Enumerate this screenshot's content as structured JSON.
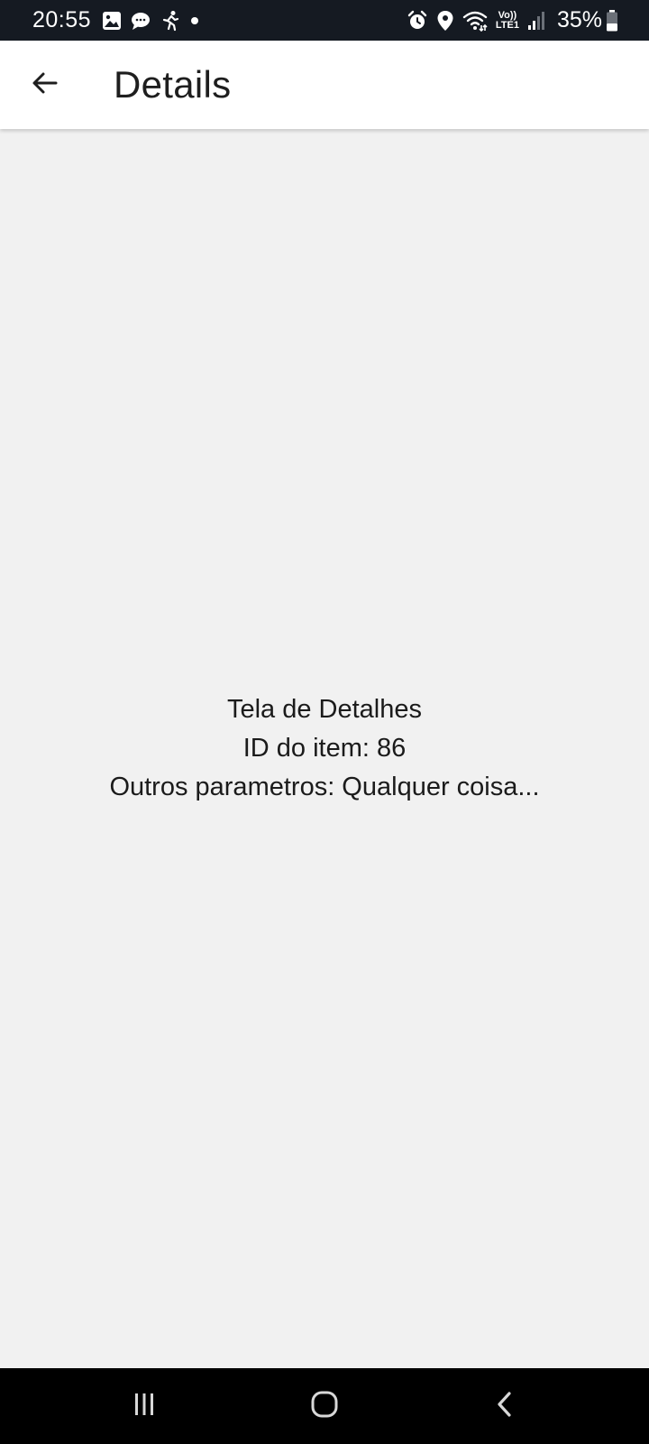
{
  "status_bar": {
    "time": "20:55",
    "battery_percent": "35%",
    "network_label_top": "Vo))",
    "network_label_bottom": "LTE1",
    "left_icons": [
      "gallery-icon",
      "chat-bubble-icon",
      "running-person-icon",
      "notification-dot-icon"
    ],
    "right_icons": [
      "alarm-icon",
      "location-pin-icon",
      "wifi-icon",
      "volte-lte-icon",
      "signal-icon",
      "battery-icon"
    ]
  },
  "app_bar": {
    "back_icon": "arrow-back-icon",
    "title": "Details"
  },
  "content": {
    "lines": [
      "Tela de Detalhes",
      "ID do item: 86",
      "Outros parametros: Qualquer coisa..."
    ]
  },
  "nav_bar": {
    "buttons": [
      "recent-apps-icon",
      "home-icon",
      "back-nav-icon"
    ]
  },
  "colors": {
    "status_bar_bg": "#151a22",
    "app_bar_bg": "#ffffff",
    "page_bg": "#f1f1f1",
    "nav_bar_bg": "#000000",
    "text": "#1b1b1b"
  }
}
